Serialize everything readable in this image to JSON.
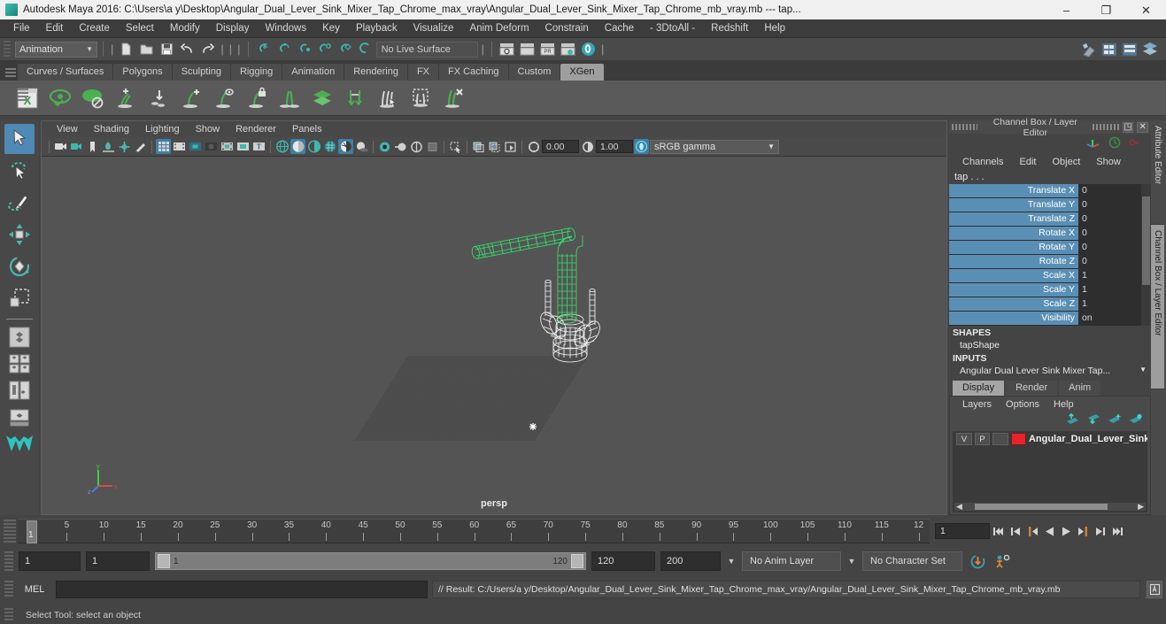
{
  "window": {
    "title": "Autodesk Maya 2016: C:\\Users\\a y\\Desktop\\Angular_Dual_Lever_Sink_Mixer_Tap_Chrome_max_vray\\Angular_Dual_Lever_Sink_Mixer_Tap_Chrome_mb_vray.mb  ---  tap...",
    "minimize": "–",
    "maximize": "❐",
    "close": "✕"
  },
  "menubar": {
    "items": [
      "File",
      "Edit",
      "Create",
      "Select",
      "Modify",
      "Display",
      "Windows",
      "Key",
      "Playback",
      "Visualize",
      "Anim Deform",
      "Constrain",
      "Cache",
      "- 3DtoAll -",
      "Redshift",
      "Help"
    ]
  },
  "statusline": {
    "mode": "Animation",
    "live_surface": "No Live Surface"
  },
  "shelf": {
    "tabs": [
      "Curves / Surfaces",
      "Polygons",
      "Sculpting",
      "Rigging",
      "Animation",
      "Rendering",
      "FX",
      "FX Caching",
      "Custom",
      "XGen"
    ],
    "active_tab": "XGen",
    "icons": [
      "xgen-editor-icon",
      "xgen-preview-icon",
      "xgen-disable-preview-icon",
      "xgen-add-description-icon",
      "xgen-import-icon",
      "xgen-add-guide-icon",
      "xgen-show-guide-icon",
      "xgen-lock-guide-icon",
      "xgen-mirror-guide-icon",
      "xgen-layers-icon",
      "xgen-groom-icon",
      "xgen-select-guides-icon",
      "xgen-region-icon",
      "xgen-delete-guides-icon"
    ]
  },
  "toolbox": {
    "items": [
      "select-tool",
      "lasso-select-tool",
      "paint-select-tool",
      "move-tool",
      "rotate-tool",
      "scale-tool"
    ],
    "active": "select-tool",
    "layout_items": [
      "single-pane-layout",
      "four-pane-layout",
      "two-pane-layout",
      "persp-outliner-layout",
      "maya-logo"
    ]
  },
  "viewport": {
    "menus": [
      "View",
      "Shading",
      "Lighting",
      "Show",
      "Renderer",
      "Panels"
    ],
    "camera_label": "persp",
    "exposure": "0.00",
    "gamma": "1.00",
    "color_space": "sRGB gamma",
    "toolbar_icons": [
      "camera-icon",
      "camera-attributes-icon",
      "bookmark-icon",
      "image-plane-icon",
      "2d-pan-zoom-icon",
      "grease-pencil-icon",
      "grid-icon",
      "film-gate-icon",
      "resolution-gate-icon",
      "gate-mask-icon",
      "film-origin-icon",
      "safe-action-icon",
      "safe-title-icon",
      "wireframe-icon",
      "smooth-shade-icon",
      "shaded-wireframe-icon",
      "textured-icon",
      "lighting-icon",
      "shadows-icon",
      "ao-icon",
      "motion-blur-icon",
      "multisample-icon",
      "isolate-select-icon",
      "xray-icon",
      "xray-joints-icon",
      "xray-active-icon",
      "exposure-icon",
      "gamma-icon",
      "view-transform-icon"
    ]
  },
  "channel_box": {
    "panel_title": "Channel Box / Layer Editor",
    "menus": [
      "Channels",
      "Edit",
      "Object",
      "Show"
    ],
    "object_name": "tap . . .",
    "attributes": [
      {
        "label": "Translate X",
        "value": "0"
      },
      {
        "label": "Translate Y",
        "value": "0"
      },
      {
        "label": "Translate Z",
        "value": "0"
      },
      {
        "label": "Rotate X",
        "value": "0"
      },
      {
        "label": "Rotate Y",
        "value": "0"
      },
      {
        "label": "Rotate Z",
        "value": "0"
      },
      {
        "label": "Scale X",
        "value": "1"
      },
      {
        "label": "Scale Y",
        "value": "1"
      },
      {
        "label": "Scale Z",
        "value": "1"
      },
      {
        "label": "Visibility",
        "value": "on"
      }
    ],
    "shapes_header": "SHAPES",
    "shape_name": "tapShape",
    "inputs_header": "INPUTS",
    "input_name": "Angular  Dual  Lever  Sink  Mixer  Tap..."
  },
  "layer_editor": {
    "tabs": [
      "Display",
      "Render",
      "Anim"
    ],
    "active_tab": "Display",
    "menus": [
      "Layers",
      "Options",
      "Help"
    ],
    "icon_buttons": [
      "move-layer-up-icon",
      "move-layer-down-icon",
      "new-layer-icon",
      "new-layer-from-selected-icon"
    ],
    "layers": [
      {
        "visibility": "V",
        "playback": "P",
        "shading": "",
        "color": "#e8232a",
        "name": "Angular_Dual_Lever_Sink"
      }
    ]
  },
  "side_tabs": {
    "items": [
      "Attribute Editor",
      "Channel Box / Layer Editor"
    ],
    "active": "Channel Box / Layer Editor"
  },
  "timeline": {
    "start": 1,
    "end": 120,
    "current_frame": "1",
    "tick_labels": [
      "5",
      "10",
      "15",
      "20",
      "25",
      "30",
      "35",
      "40",
      "45",
      "50",
      "55",
      "60",
      "65",
      "70",
      "75",
      "80",
      "85",
      "90",
      "95",
      "100",
      "105",
      "110",
      "115",
      "12"
    ],
    "playback_buttons": [
      "go-to-start-icon",
      "step-back-keyframe-icon",
      "step-back-frame-icon",
      "play-backwards-icon",
      "play-forwards-icon",
      "step-forward-frame-icon",
      "step-forward-keyframe-icon",
      "go-to-end-icon"
    ]
  },
  "range_slider": {
    "anim_start": "1",
    "range_start": "1",
    "bar_start": "1",
    "bar_end": "120",
    "range_end": "120",
    "anim_end": "200",
    "anim_layer": "No Anim Layer",
    "character_set": "No Character Set",
    "icons": [
      "auto-keyframe-icon",
      "animation-preferences-icon"
    ]
  },
  "command_line": {
    "label": "MEL",
    "input_value": "",
    "result": "// Result: C:/Users/a y/Desktop/Angular_Dual_Lever_Sink_Mixer_Tap_Chrome_max_vray/Angular_Dual_Lever_Sink_Mixer_Tap_Chrome_mb_vray.mb",
    "script_editor_icon": "script-editor-icon"
  },
  "status_bar": {
    "message": "Select Tool: select an object"
  },
  "colors": {
    "accent_blue": "#5a8fb5",
    "teal": "#2ba8a0",
    "xgen_green": "#4caf50",
    "layer_red": "#e8232a",
    "viewport_bg": "#545454",
    "selection_green": "#33e06a"
  }
}
